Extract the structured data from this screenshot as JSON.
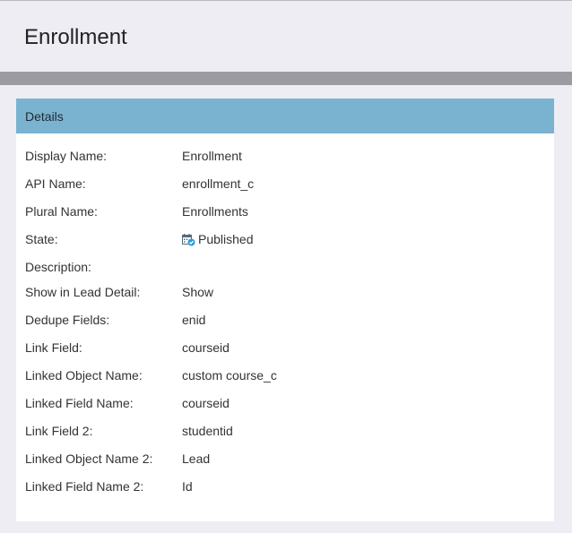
{
  "page": {
    "title": "Enrollment"
  },
  "panel": {
    "header": "Details",
    "rows": [
      {
        "label": "Display Name:",
        "value": "Enrollment"
      },
      {
        "label": "API Name:",
        "value": "enrollment_c"
      },
      {
        "label": "Plural Name:",
        "value": "Enrollments"
      },
      {
        "label": "State:",
        "value": "Published",
        "icon": "published-calendar-check-icon"
      },
      {
        "label": "Description:",
        "value": ""
      },
      {
        "label": "Show in Lead Detail:",
        "value": "Show"
      },
      {
        "label": "Dedupe Fields:",
        "value": "enid"
      },
      {
        "label": "Link Field:",
        "value": "courseid"
      },
      {
        "label": "Linked Object Name:",
        "value": "custom course_c"
      },
      {
        "label": "Linked Field Name:",
        "value": "courseid"
      },
      {
        "label": "Link Field 2:",
        "value": "studentid"
      },
      {
        "label": "Linked Object Name 2:",
        "value": "Lead"
      },
      {
        "label": "Linked Field Name 2:",
        "value": "Id"
      }
    ]
  },
  "colors": {
    "panel_header": "#7ab3cf",
    "divider": "#9c9ca0",
    "background": "#ededf3"
  }
}
